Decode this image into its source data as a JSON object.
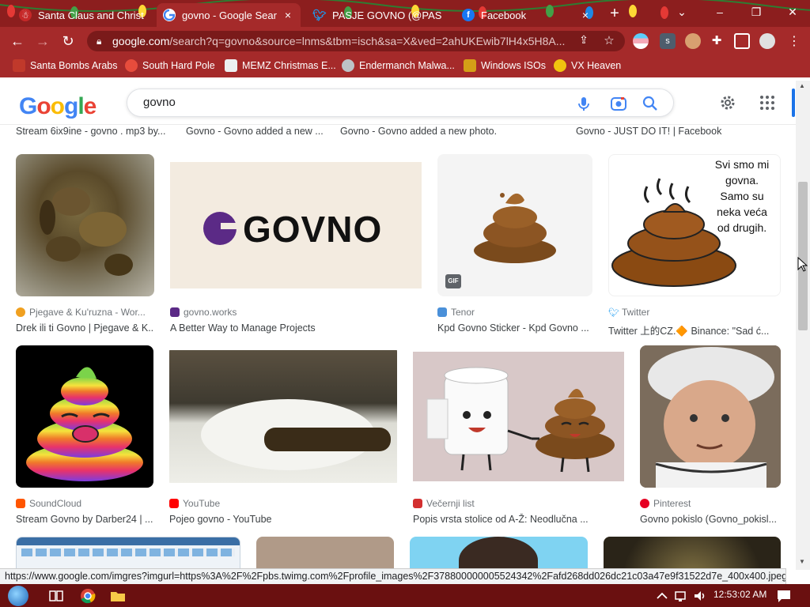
{
  "browser": {
    "tabs": [
      {
        "title": "Santa Claus and Christ",
        "favicon": "snowman-icon",
        "active": false
      },
      {
        "title": "govno - Google Search",
        "favicon": "google-icon",
        "active": true
      },
      {
        "title": "PASJE GOVNO (@PAS",
        "favicon": "twitter-icon",
        "active": false
      },
      {
        "title": "Facebook",
        "favicon": "facebook-icon",
        "active": false
      }
    ],
    "new_tab_label": "+",
    "close_glyph": "×",
    "url_host": "google.com",
    "url_rest": "/search?q=govno&source=lnms&tbm=isch&sa=X&ved=2ahUKEwib7lH4x5H8A...",
    "bookmarks": [
      {
        "label": "Santa Bombs Arabs",
        "icon": "santa-icon",
        "color": "#c0392b"
      },
      {
        "label": "South Hard Pole",
        "icon": "snowflake-icon",
        "color": "#e74c3c"
      },
      {
        "label": "MEMZ Christmas E...",
        "icon": "window-icon",
        "color": "#ecf0f1"
      },
      {
        "label": "Endermanch Malwa...",
        "icon": "raccoon-icon",
        "color": "#bdc3c7"
      },
      {
        "label": "Windows ISOs",
        "icon": "trophy-icon",
        "color": "#d4a017"
      },
      {
        "label": "VX Heaven",
        "icon": "biohazard-icon",
        "color": "#f1c40f"
      }
    ]
  },
  "google": {
    "logo_letters": [
      "G",
      "o",
      "o",
      "g",
      "l",
      "e"
    ],
    "logo_colors": [
      "#4285f4",
      "#ea4335",
      "#fbbc05",
      "#4285f4",
      "#34a853",
      "#ea4335"
    ],
    "query": "govno"
  },
  "top_captions": [
    "Stream 6ix9ine - govno . mp3 by...",
    "Govno - Govno added a new ...",
    "Govno - Govno added a new photo.",
    "Govno - JUST DO IT! | Facebook"
  ],
  "results_row1": [
    {
      "source": "Pjegave & Ku'ruzna - Wor...",
      "caption": "Drek ili ti Govno | Pjegave & K...",
      "icon_color": "#f0a020"
    },
    {
      "source": "govno.works",
      "caption": "A Better Way to Manage Projects",
      "icon_color": "#5b2a86",
      "logo_text": "GOVNO"
    },
    {
      "source": "Tenor",
      "caption": "Kpd Govno Sticker - Kpd Govno ...",
      "icon_color": "#4a90d9",
      "badge": "GIF"
    },
    {
      "source": "Twitter",
      "caption": "Twitter 上的CZ.🔶 Binance: \"Sad ć...",
      "icon_color": "#1d9bf0",
      "quote": [
        "Svi smo mi",
        "govna.",
        "Samo su",
        "neka veća",
        "od drugih."
      ]
    }
  ],
  "results_row2": [
    {
      "source": "SoundCloud",
      "caption": "Stream Govno by Darber24 | ...",
      "icon_color": "#ff5500"
    },
    {
      "source": "YouTube",
      "caption": "Pojeo govno - YouTube",
      "icon_color": "#ff0000"
    },
    {
      "source": "Večernji list",
      "caption": "Popis vrsta stolice od A-Ž: Neodlučna ...",
      "icon_color": "#d32f2f"
    },
    {
      "source": "Pinterest",
      "caption": "Govno pokislo (Govno_pokisl...",
      "icon_color": "#e60023"
    }
  ],
  "status_url": "https://www.google.com/imgres?imgurl=https%3A%2F%2Fpbs.twimg.com%2Fprofile_images%2F378800000005524342%2Fafd268dd026dc21c03a47e9f31522d7e_400x400.jpeg&imgre...",
  "taskbar": {
    "clock": "12:53:02 AM"
  }
}
